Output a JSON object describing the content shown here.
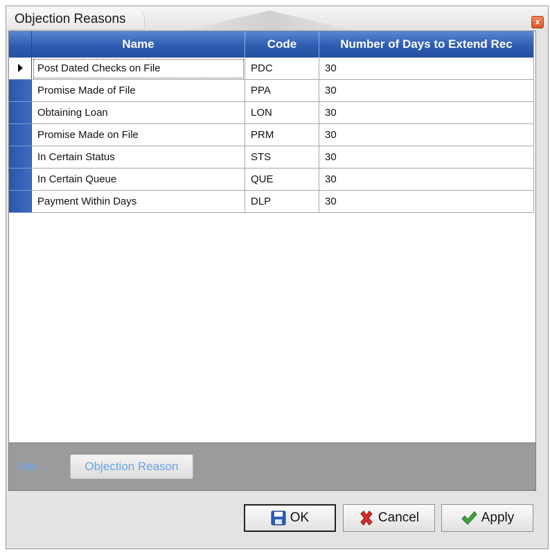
{
  "window": {
    "title": "Objection Reasons",
    "close_glyph": "x"
  },
  "grid": {
    "columns": [
      "Name",
      "Code",
      "Number of Days to Extend Rec"
    ],
    "rows": [
      {
        "name": "Post Dated Checks on File",
        "code": "PDC",
        "days": "30"
      },
      {
        "name": "Promise Made of File",
        "code": "PPA",
        "days": "30"
      },
      {
        "name": "Obtaining Loan",
        "code": "LON",
        "days": "30"
      },
      {
        "name": "Promise Made on File",
        "code": "PRM",
        "days": "30"
      },
      {
        "name": "In Certain Status",
        "code": "STS",
        "days": "30"
      },
      {
        "name": "In Certain Queue",
        "code": "QUE",
        "days": "30"
      },
      {
        "name": "Payment Within Days",
        "code": "DLP",
        "days": "30"
      }
    ],
    "current_row": 0
  },
  "add_bar": {
    "label": "Add ...",
    "button_label": "Objection Reason"
  },
  "buttons": {
    "ok": "OK",
    "cancel": "Cancel",
    "apply": "Apply"
  },
  "icons": {
    "ok": "save-disk-icon",
    "cancel": "red-x-icon",
    "apply": "green-check-icon"
  },
  "colors": {
    "header_blue": "#2d5cb0",
    "link_blue": "#6ea3e8",
    "close_orange": "#e06535"
  }
}
